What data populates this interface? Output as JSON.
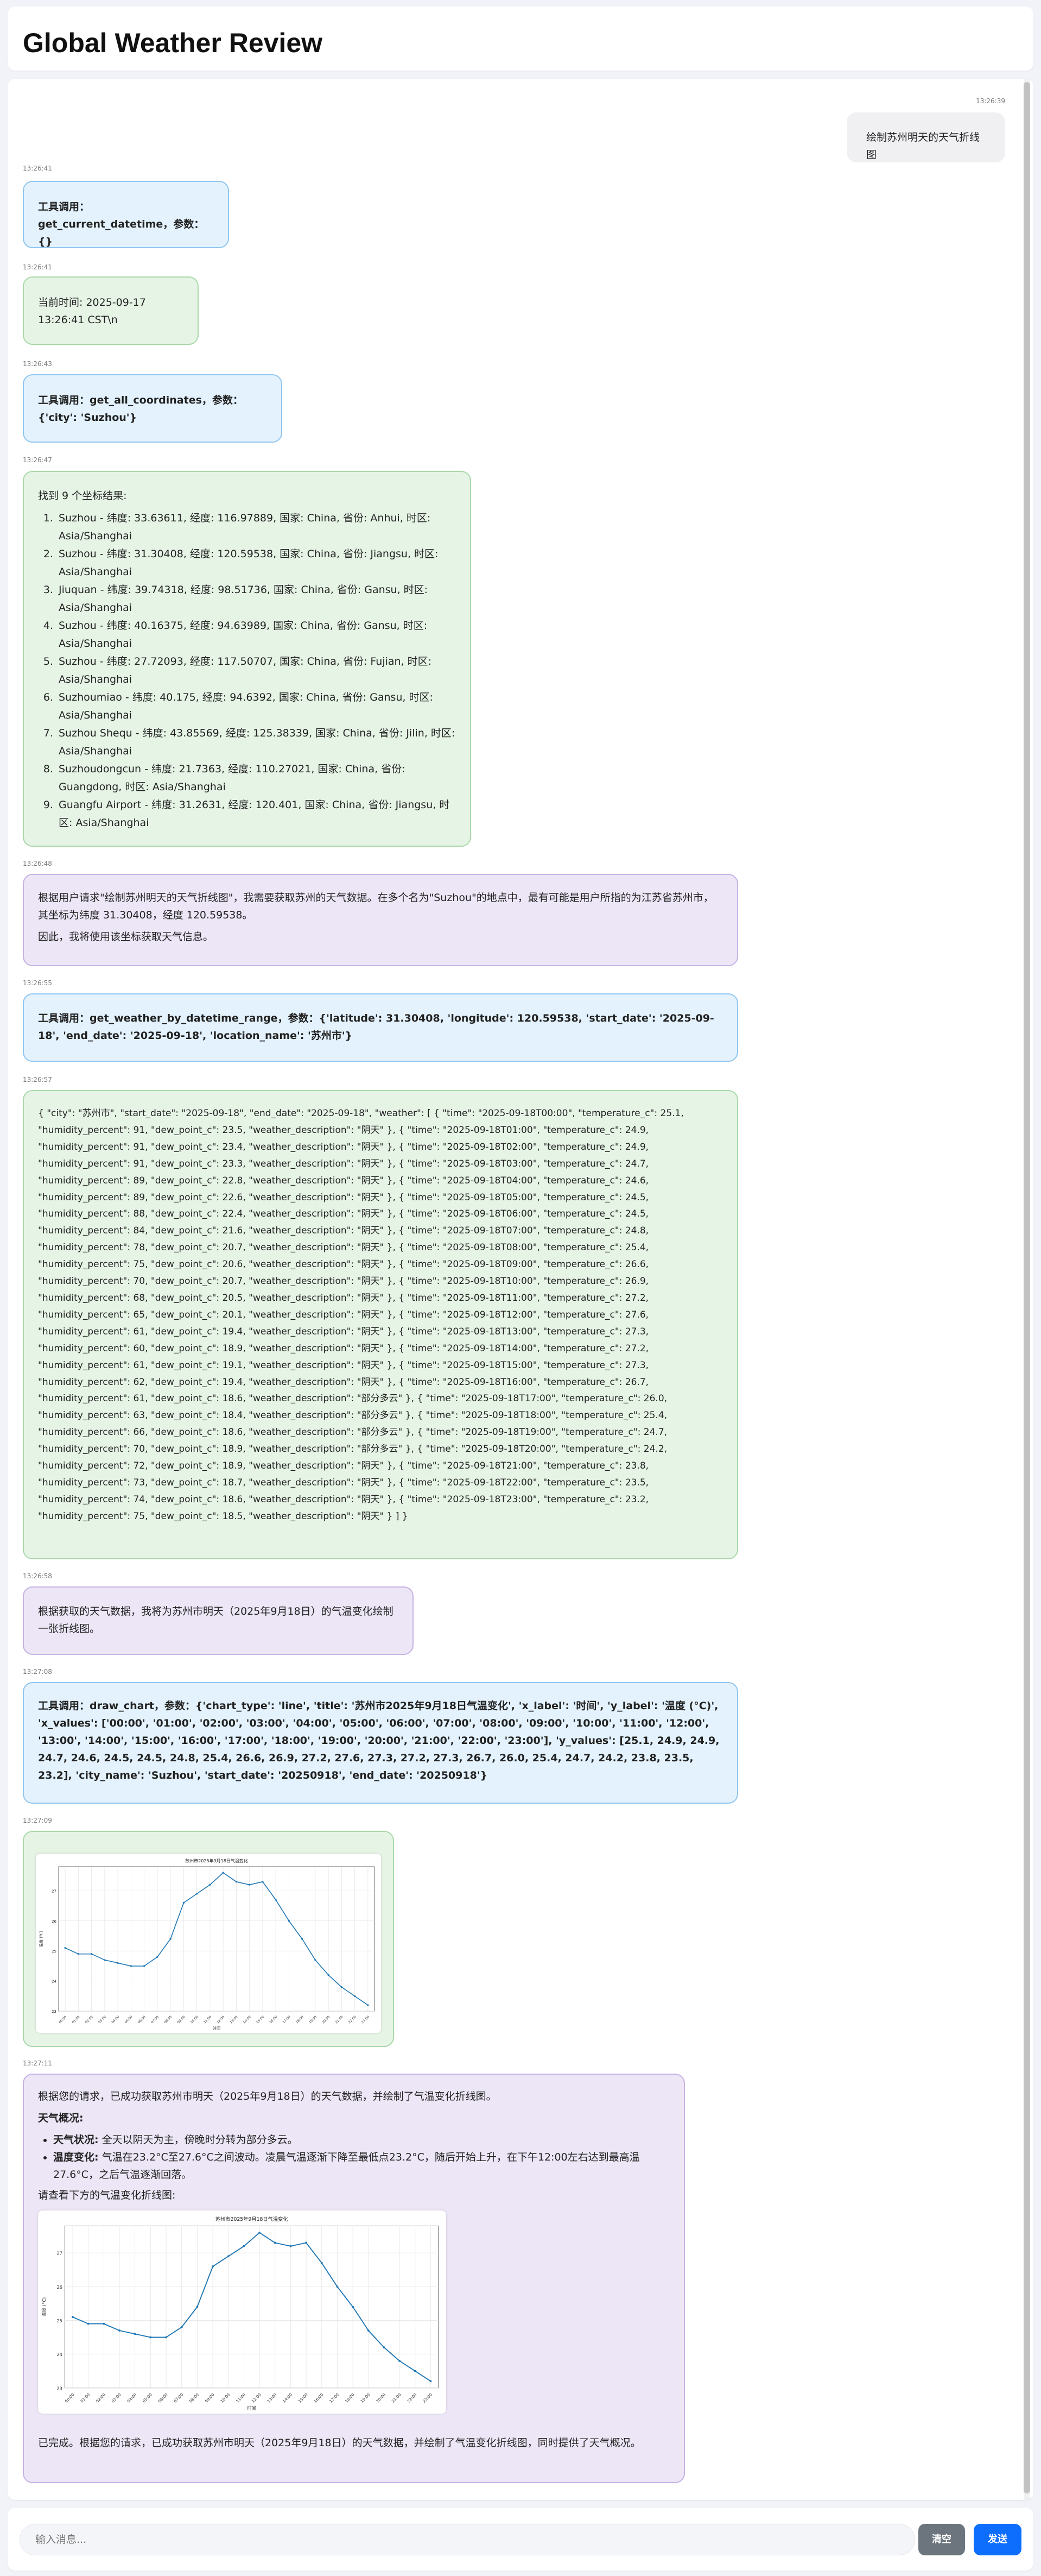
{
  "app": {
    "title": "Global Weather Review"
  },
  "messages": [
    {
      "type": "user",
      "time": "13:26:39",
      "text": "绘制苏州明天的天气折线图"
    },
    {
      "type": "tool",
      "time": "13:26:41",
      "text": "工具调用：get_current_datetime，参数：{}"
    },
    {
      "type": "result",
      "time": "13:26:41",
      "text": "当前时间: 2025-09-17 13:26:41 CST\\n"
    },
    {
      "type": "tool",
      "time": "13:26:43",
      "text": "工具调用：get_all_coordinates，参数：{'city': 'Suzhou'}"
    },
    {
      "type": "result",
      "time": "13:26:47",
      "intro": "找到 9 个坐标结果:",
      "items": [
        "Suzhou - 纬度: 33.63611, 经度: 116.97889, 国家: China, 省份: Anhui, 时区: Asia/Shanghai",
        "Suzhou - 纬度: 31.30408, 经度: 120.59538, 国家: China, 省份: Jiangsu, 时区: Asia/Shanghai",
        "Jiuquan - 纬度: 39.74318, 经度: 98.51736, 国家: China, 省份: Gansu, 时区: Asia/Shanghai",
        "Suzhou - 纬度: 40.16375, 经度: 94.63989, 国家: China, 省份: Gansu, 时区: Asia/Shanghai",
        "Suzhou - 纬度: 27.72093, 经度: 117.50707, 国家: China, 省份: Fujian, 时区: Asia/Shanghai",
        "Suzhoumiao - 纬度: 40.175, 经度: 94.6392, 国家: China, 省份: Gansu, 时区: Asia/Shanghai",
        "Suzhou Shequ - 纬度: 43.85569, 经度: 125.38339, 国家: China, 省份: Jilin, 时区: Asia/Shanghai",
        "Suzhoudongcun - 纬度: 21.7363, 经度: 110.27021, 国家: China, 省份: Guangdong, 时区: Asia/Shanghai",
        "Guangfu Airport - 纬度: 31.2631, 经度: 120.401, 国家: China, 省份: Jiangsu, 时区: Asia/Shanghai"
      ]
    },
    {
      "type": "ai",
      "time": "13:26:48",
      "lines": [
        "根据用户请求\"绘制苏州明天的天气折线图\"，我需要获取苏州的天气数据。在多个名为\"Suzhou\"的地点中，最有可能是用户所指的为江苏省苏州市，其坐标为纬度 31.30408，经度 120.59538。",
        "因此，我将使用该坐标获取天气信息。"
      ]
    },
    {
      "type": "tool",
      "time": "13:26:55",
      "text": "工具调用：get_weather_by_datetime_range，参数：{'latitude': 31.30408, 'longitude': 120.59538, 'start_date': '2025-09-18', 'end_date': '2025-09-18', 'location_name': '苏州市'}"
    },
    {
      "type": "result",
      "time": "13:26:57",
      "text": "{ \"city\": \"苏州市\", \"start_date\": \"2025-09-18\", \"end_date\": \"2025-09-18\", \"weather\": [ { \"time\": \"2025-09-18T00:00\", \"temperature_c\": 25.1, \"humidity_percent\": 91, \"dew_point_c\": 23.5, \"weather_description\": \"阴天\" }, { \"time\": \"2025-09-18T01:00\", \"temperature_c\": 24.9, \"humidity_percent\": 91, \"dew_point_c\": 23.4, \"weather_description\": \"阴天\" }, { \"time\": \"2025-09-18T02:00\", \"temperature_c\": 24.9, \"humidity_percent\": 91, \"dew_point_c\": 23.3, \"weather_description\": \"阴天\" }, { \"time\": \"2025-09-18T03:00\", \"temperature_c\": 24.7, \"humidity_percent\": 89, \"dew_point_c\": 22.8, \"weather_description\": \"阴天\" }, { \"time\": \"2025-09-18T04:00\", \"temperature_c\": 24.6, \"humidity_percent\": 89, \"dew_point_c\": 22.6, \"weather_description\": \"阴天\" }, { \"time\": \"2025-09-18T05:00\", \"temperature_c\": 24.5, \"humidity_percent\": 88, \"dew_point_c\": 22.4, \"weather_description\": \"阴天\" }, { \"time\": \"2025-09-18T06:00\", \"temperature_c\": 24.5, \"humidity_percent\": 84, \"dew_point_c\": 21.6, \"weather_description\": \"阴天\" }, { \"time\": \"2025-09-18T07:00\", \"temperature_c\": 24.8, \"humidity_percent\": 78, \"dew_point_c\": 20.7, \"weather_description\": \"阴天\" }, { \"time\": \"2025-09-18T08:00\", \"temperature_c\": 25.4, \"humidity_percent\": 75, \"dew_point_c\": 20.6, \"weather_description\": \"阴天\" }, { \"time\": \"2025-09-18T09:00\", \"temperature_c\": 26.6, \"humidity_percent\": 70, \"dew_point_c\": 20.7, \"weather_description\": \"阴天\" }, { \"time\": \"2025-09-18T10:00\", \"temperature_c\": 26.9, \"humidity_percent\": 68, \"dew_point_c\": 20.5, \"weather_description\": \"阴天\" }, { \"time\": \"2025-09-18T11:00\", \"temperature_c\": 27.2, \"humidity_percent\": 65, \"dew_point_c\": 20.1, \"weather_description\": \"阴天\" }, { \"time\": \"2025-09-18T12:00\", \"temperature_c\": 27.6, \"humidity_percent\": 61, \"dew_point_c\": 19.4, \"weather_description\": \"阴天\" }, { \"time\": \"2025-09-18T13:00\", \"temperature_c\": 27.3, \"humidity_percent\": 60, \"dew_point_c\": 18.9, \"weather_description\": \"阴天\" }, { \"time\": \"2025-09-18T14:00\", \"temperature_c\": 27.2, \"humidity_percent\": 61, \"dew_point_c\": 19.1, \"weather_description\": \"阴天\" }, { \"time\": \"2025-09-18T15:00\", \"temperature_c\": 27.3, \"humidity_percent\": 62, \"dew_point_c\": 19.4, \"weather_description\": \"阴天\" }, { \"time\": \"2025-09-18T16:00\", \"temperature_c\": 26.7, \"humidity_percent\": 61, \"dew_point_c\": 18.6, \"weather_description\": \"部分多云\" }, { \"time\": \"2025-09-18T17:00\", \"temperature_c\": 26.0, \"humidity_percent\": 63, \"dew_point_c\": 18.4, \"weather_description\": \"部分多云\" }, { \"time\": \"2025-09-18T18:00\", \"temperature_c\": 25.4, \"humidity_percent\": 66, \"dew_point_c\": 18.6, \"weather_description\": \"部分多云\" }, { \"time\": \"2025-09-18T19:00\", \"temperature_c\": 24.7, \"humidity_percent\": 70, \"dew_point_c\": 18.9, \"weather_description\": \"部分多云\" }, { \"time\": \"2025-09-18T20:00\", \"temperature_c\": 24.2, \"humidity_percent\": 72, \"dew_point_c\": 18.9, \"weather_description\": \"阴天\" }, { \"time\": \"2025-09-18T21:00\", \"temperature_c\": 23.8, \"humidity_percent\": 73, \"dew_point_c\": 18.7, \"weather_description\": \"阴天\" }, { \"time\": \"2025-09-18T22:00\", \"temperature_c\": 23.5, \"humidity_percent\": 74, \"dew_point_c\": 18.6, \"weather_description\": \"阴天\" }, { \"time\": \"2025-09-18T23:00\", \"temperature_c\": 23.2, \"humidity_percent\": 75, \"dew_point_c\": 18.5, \"weather_description\": \"阴天\" } ] }"
    },
    {
      "type": "ai",
      "time": "13:26:58",
      "lines": [
        "根据获取的天气数据，我将为苏州市明天（2025年9月18日）的气温变化绘制一张折线图。"
      ]
    },
    {
      "type": "tool",
      "time": "13:27:08",
      "text": "工具调用：draw_chart，参数：{'chart_type': 'line', 'title': '苏州市2025年9月18日气温变化', 'x_label': '时间', 'y_label': '温度 (°C)', 'x_values': ['00:00', '01:00', '02:00', '03:00', '04:00', '05:00', '06:00', '07:00', '08:00', '09:00', '10:00', '11:00', '12:00', '13:00', '14:00', '15:00', '16:00', '17:00', '18:00', '19:00', '20:00', '21:00', '22:00', '23:00'], 'y_values': [25.1, 24.9, 24.9, 24.7, 24.6, 24.5, 24.5, 24.8, 25.4, 26.6, 26.9, 27.2, 27.6, 27.3, 27.2, 27.3, 26.7, 26.0, 25.4, 24.7, 24.2, 23.8, 23.5, 23.2], 'city_name': 'Suzhou', 'start_date': '20250918', 'end_date': '20250918'}"
    },
    {
      "type": "chart",
      "time": "13:27:09"
    },
    {
      "type": "ai-final",
      "time": "13:27:11",
      "intro": "根据您的请求，已成功获取苏州市明天（2025年9月18日）的天气数据，并绘制了气温变化折线图。",
      "summary_heading": "天气概况:",
      "bullets": [
        {
          "label": "天气状况:",
          "text": "全天以阴天为主，傍晚时分转为部分多云。"
        },
        {
          "label": "温度变化:",
          "text": "气温在23.2°C至27.6°C之间波动。凌晨气温逐渐下降至最低点23.2°C，随后开始上升，在下午12:00左右达到最高温27.6°C，之后气温逐渐回落。"
        }
      ],
      "chart_lead": "请查看下方的气温变化折线图:",
      "closing": "已完成。根据您的请求，已成功获取苏州市明天（2025年9月18日）的天气数据，并绘制了气温变化折线图，同时提供了天气概况。"
    }
  ],
  "chart_data": {
    "type": "line",
    "title": "苏州市2025年9月18日气温变化",
    "xlabel": "时间",
    "ylabel": "温度 (°C)",
    "x": [
      "00:00",
      "01:00",
      "02:00",
      "03:00",
      "04:00",
      "05:00",
      "06:00",
      "07:00",
      "08:00",
      "09:00",
      "10:00",
      "11:00",
      "12:00",
      "13:00",
      "14:00",
      "15:00",
      "16:00",
      "17:00",
      "18:00",
      "19:00",
      "20:00",
      "21:00",
      "22:00",
      "23:00"
    ],
    "series": [
      {
        "values": [
          25.1,
          24.9,
          24.9,
          24.7,
          24.6,
          24.5,
          24.5,
          24.8,
          25.4,
          26.6,
          26.9,
          27.2,
          27.6,
          27.3,
          27.2,
          27.3,
          26.7,
          26.0,
          25.4,
          24.7,
          24.2,
          23.8,
          23.5,
          23.2
        ]
      }
    ],
    "yticks": [
      23,
      24,
      25,
      26,
      27
    ],
    "ylim": [
      23,
      27.8
    ],
    "grid": true,
    "color": "#1f77b4"
  },
  "input": {
    "placeholder": "输入消息..."
  },
  "buttons": {
    "clear": "清空",
    "send": "发送"
  }
}
